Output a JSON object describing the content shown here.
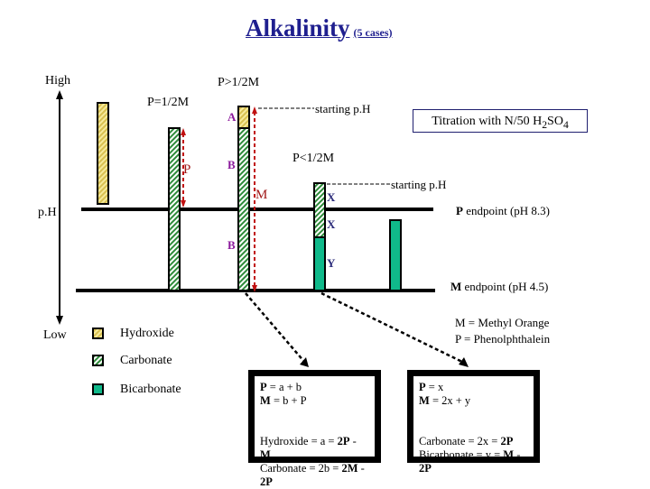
{
  "title": {
    "main": "Alkalinity",
    "sub": "(5 cases)"
  },
  "axis": {
    "high": "High",
    "low": "Low",
    "ph": "p.H"
  },
  "cases": {
    "p_gt_half_m": "P>1/2M",
    "p_eq_half_m": "P=1/2M",
    "p_lt_half_m": "P<1/2M"
  },
  "labels": {
    "starting_ph_1": "starting p.H",
    "starting_ph_2": "starting p.H",
    "a": "A",
    "b_upper": "B",
    "b_lower": "B",
    "p_arrow": "P",
    "m_arrow": "M",
    "x_upper": "X",
    "x_lower": "X",
    "y": "Y"
  },
  "titration": {
    "text": "Titration with N/50 ",
    "formula_h": "H",
    "formula_2": "2",
    "formula_so": "SO",
    "formula_4": "4"
  },
  "endpoints": {
    "p_letter": "P",
    "p_text": " endpoint (pH 8.3)",
    "m_letter": "M",
    "m_text": " endpoint (pH 4.5)"
  },
  "indicators": {
    "m": "M = Methyl Orange",
    "p": "P = Phenolphthalein"
  },
  "legend": [
    {
      "label": "Hydroxide",
      "type": "hydroxide"
    },
    {
      "label": "Carbonate",
      "type": "carbonate"
    },
    {
      "label": "Bicarbonate",
      "type": "bicarbonate"
    }
  ],
  "box_left": {
    "line1_bold": "P",
    "line1_rest": " = a + b",
    "line2_bold": "M",
    "line2_rest": " = b + P",
    "line3_text": "Hydroxide = a = ",
    "line3_bold": "2P",
    "line3_mid": " - ",
    "line3_bold2": "M",
    "line4_text": "Carbonate = 2b = ",
    "line4_bold": "2M",
    "line4_mid": " - ",
    "line4_bold2": "2P"
  },
  "box_right": {
    "line1_bold": "P",
    "line1_rest": " = x",
    "line2_bold": "M",
    "line2_rest": " = 2x + y",
    "line3_text": "Carbonate = 2x = ",
    "line3_bold": "2P",
    "line4_text": "Bicarbonate = y = ",
    "line4_bold": "M",
    "line4_mid": " - ",
    "line4_bold2": "2P"
  },
  "colors": {
    "hydroxide": "#e8d36a",
    "carbonate": "#2e8b3a",
    "bicarbonate": "#10b98a",
    "arrow_red": "#a01818",
    "title": "#1f1f8f"
  }
}
